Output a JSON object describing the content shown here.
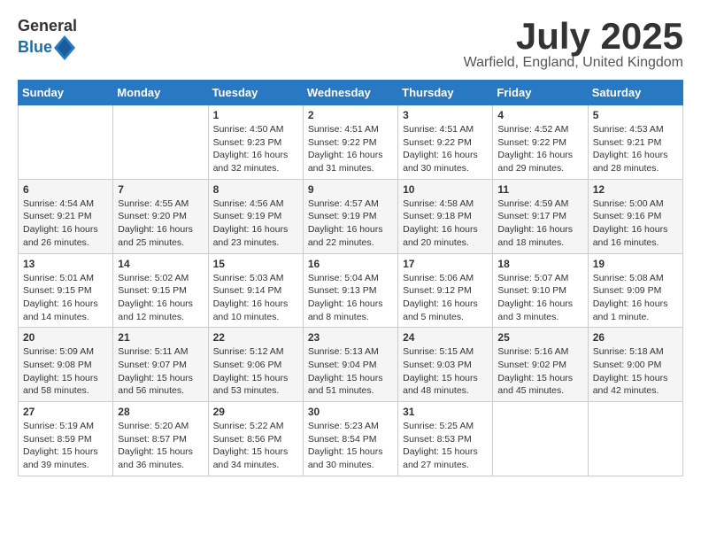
{
  "logo": {
    "general": "General",
    "blue": "Blue"
  },
  "header": {
    "month": "July 2025",
    "location": "Warfield, England, United Kingdom"
  },
  "weekdays": [
    "Sunday",
    "Monday",
    "Tuesday",
    "Wednesday",
    "Thursday",
    "Friday",
    "Saturday"
  ],
  "weeks": [
    [
      {
        "day": "",
        "info": ""
      },
      {
        "day": "",
        "info": ""
      },
      {
        "day": "1",
        "info": "Sunrise: 4:50 AM\nSunset: 9:23 PM\nDaylight: 16 hours and 32 minutes."
      },
      {
        "day": "2",
        "info": "Sunrise: 4:51 AM\nSunset: 9:22 PM\nDaylight: 16 hours and 31 minutes."
      },
      {
        "day": "3",
        "info": "Sunrise: 4:51 AM\nSunset: 9:22 PM\nDaylight: 16 hours and 30 minutes."
      },
      {
        "day": "4",
        "info": "Sunrise: 4:52 AM\nSunset: 9:22 PM\nDaylight: 16 hours and 29 minutes."
      },
      {
        "day": "5",
        "info": "Sunrise: 4:53 AM\nSunset: 9:21 PM\nDaylight: 16 hours and 28 minutes."
      }
    ],
    [
      {
        "day": "6",
        "info": "Sunrise: 4:54 AM\nSunset: 9:21 PM\nDaylight: 16 hours and 26 minutes."
      },
      {
        "day": "7",
        "info": "Sunrise: 4:55 AM\nSunset: 9:20 PM\nDaylight: 16 hours and 25 minutes."
      },
      {
        "day": "8",
        "info": "Sunrise: 4:56 AM\nSunset: 9:19 PM\nDaylight: 16 hours and 23 minutes."
      },
      {
        "day": "9",
        "info": "Sunrise: 4:57 AM\nSunset: 9:19 PM\nDaylight: 16 hours and 22 minutes."
      },
      {
        "day": "10",
        "info": "Sunrise: 4:58 AM\nSunset: 9:18 PM\nDaylight: 16 hours and 20 minutes."
      },
      {
        "day": "11",
        "info": "Sunrise: 4:59 AM\nSunset: 9:17 PM\nDaylight: 16 hours and 18 minutes."
      },
      {
        "day": "12",
        "info": "Sunrise: 5:00 AM\nSunset: 9:16 PM\nDaylight: 16 hours and 16 minutes."
      }
    ],
    [
      {
        "day": "13",
        "info": "Sunrise: 5:01 AM\nSunset: 9:15 PM\nDaylight: 16 hours and 14 minutes."
      },
      {
        "day": "14",
        "info": "Sunrise: 5:02 AM\nSunset: 9:15 PM\nDaylight: 16 hours and 12 minutes."
      },
      {
        "day": "15",
        "info": "Sunrise: 5:03 AM\nSunset: 9:14 PM\nDaylight: 16 hours and 10 minutes."
      },
      {
        "day": "16",
        "info": "Sunrise: 5:04 AM\nSunset: 9:13 PM\nDaylight: 16 hours and 8 minutes."
      },
      {
        "day": "17",
        "info": "Sunrise: 5:06 AM\nSunset: 9:12 PM\nDaylight: 16 hours and 5 minutes."
      },
      {
        "day": "18",
        "info": "Sunrise: 5:07 AM\nSunset: 9:10 PM\nDaylight: 16 hours and 3 minutes."
      },
      {
        "day": "19",
        "info": "Sunrise: 5:08 AM\nSunset: 9:09 PM\nDaylight: 16 hours and 1 minute."
      }
    ],
    [
      {
        "day": "20",
        "info": "Sunrise: 5:09 AM\nSunset: 9:08 PM\nDaylight: 15 hours and 58 minutes."
      },
      {
        "day": "21",
        "info": "Sunrise: 5:11 AM\nSunset: 9:07 PM\nDaylight: 15 hours and 56 minutes."
      },
      {
        "day": "22",
        "info": "Sunrise: 5:12 AM\nSunset: 9:06 PM\nDaylight: 15 hours and 53 minutes."
      },
      {
        "day": "23",
        "info": "Sunrise: 5:13 AM\nSunset: 9:04 PM\nDaylight: 15 hours and 51 minutes."
      },
      {
        "day": "24",
        "info": "Sunrise: 5:15 AM\nSunset: 9:03 PM\nDaylight: 15 hours and 48 minutes."
      },
      {
        "day": "25",
        "info": "Sunrise: 5:16 AM\nSunset: 9:02 PM\nDaylight: 15 hours and 45 minutes."
      },
      {
        "day": "26",
        "info": "Sunrise: 5:18 AM\nSunset: 9:00 PM\nDaylight: 15 hours and 42 minutes."
      }
    ],
    [
      {
        "day": "27",
        "info": "Sunrise: 5:19 AM\nSunset: 8:59 PM\nDaylight: 15 hours and 39 minutes."
      },
      {
        "day": "28",
        "info": "Sunrise: 5:20 AM\nSunset: 8:57 PM\nDaylight: 15 hours and 36 minutes."
      },
      {
        "day": "29",
        "info": "Sunrise: 5:22 AM\nSunset: 8:56 PM\nDaylight: 15 hours and 34 minutes."
      },
      {
        "day": "30",
        "info": "Sunrise: 5:23 AM\nSunset: 8:54 PM\nDaylight: 15 hours and 30 minutes."
      },
      {
        "day": "31",
        "info": "Sunrise: 5:25 AM\nSunset: 8:53 PM\nDaylight: 15 hours and 27 minutes."
      },
      {
        "day": "",
        "info": ""
      },
      {
        "day": "",
        "info": ""
      }
    ]
  ]
}
